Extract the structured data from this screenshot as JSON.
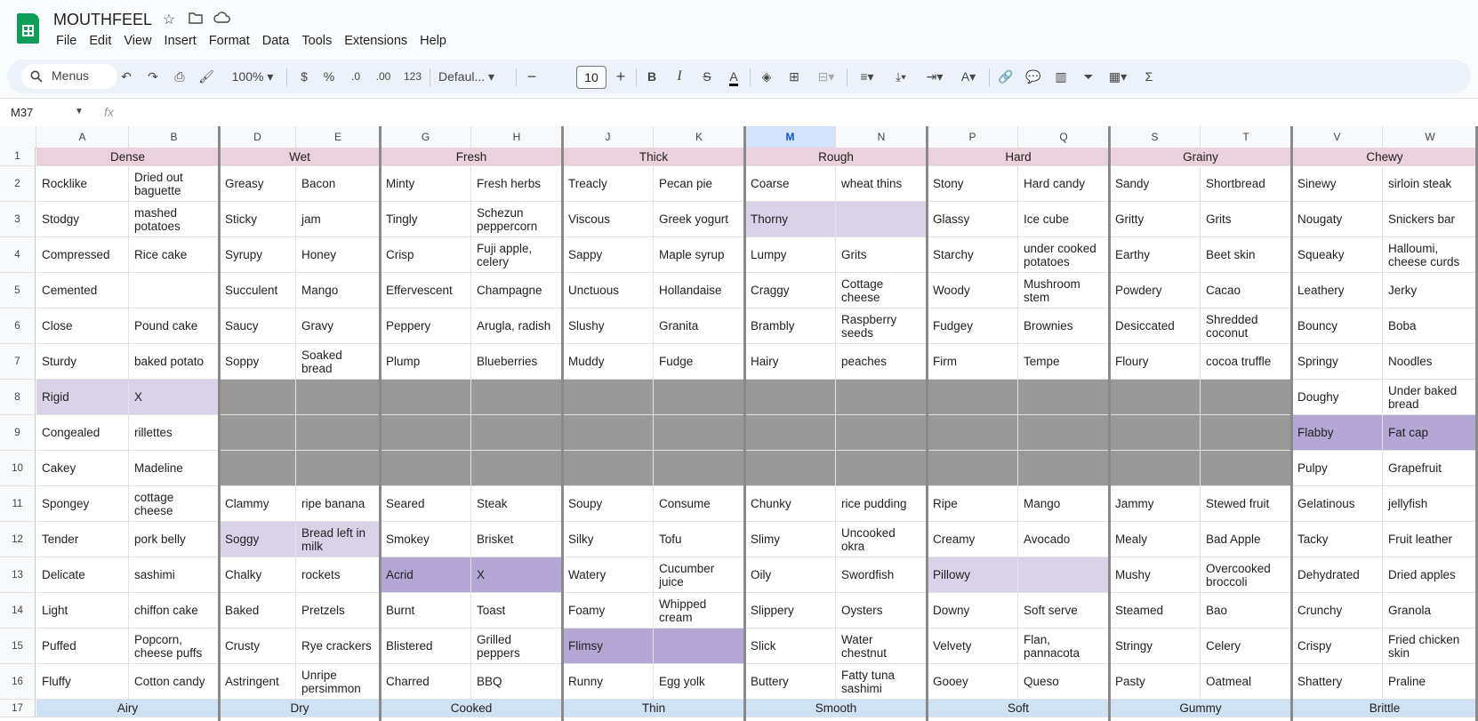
{
  "doc": {
    "title": "MOUTHFEEL"
  },
  "menu": [
    "File",
    "Edit",
    "View",
    "Insert",
    "Format",
    "Data",
    "Tools",
    "Extensions",
    "Help"
  ],
  "toolbar": {
    "search": "Menus",
    "zoom": "100%",
    "currency": "$",
    "percent": "%",
    "dec_dec": ".0",
    "inc_dec": ".00",
    "num_format": "123",
    "font": "Defaul...",
    "font_size": "10"
  },
  "formula": {
    "cell_ref": "M37",
    "fx": "fx",
    "value": ""
  },
  "columns": [
    "A",
    "B",
    "D",
    "E",
    "G",
    "H",
    "J",
    "K",
    "M",
    "N",
    "P",
    "Q",
    "S",
    "T",
    "V",
    "W"
  ],
  "selected_column": "M",
  "row_numbers": [
    "1",
    "2",
    "3",
    "4",
    "5",
    "6",
    "7",
    "8",
    "9",
    "10",
    "11",
    "12",
    "13",
    "14",
    "15",
    "16",
    "17"
  ],
  "group_headers_top": [
    "Dense",
    "Wet",
    "Fresh",
    "Thick",
    "Rough",
    "Hard",
    "Grainy",
    "Chewy"
  ],
  "group_headers_bottom": [
    "Airy",
    "Dry",
    "Cooked",
    "Thin",
    "Smooth",
    "Soft",
    "Gummy",
    "Brittle"
  ],
  "rows": [
    [
      "Rocklike",
      "Dried out baguette",
      "Greasy",
      "Bacon",
      "Minty",
      "Fresh herbs",
      "Treacly",
      "Pecan pie",
      "Coarse",
      "wheat thins",
      "Stony",
      "Hard candy",
      "Sandy",
      "Shortbread",
      "Sinewy",
      "sirloin steak"
    ],
    [
      "Stodgy",
      "mashed potatoes",
      "Sticky",
      "jam",
      "Tingly",
      "Schezun peppercorn",
      "Viscous",
      "Greek yogurt",
      "Thorny",
      "",
      "Glassy",
      "Ice cube",
      "Gritty",
      "Grits",
      "Nougaty",
      "Snickers bar"
    ],
    [
      "Compressed",
      "Rice cake",
      "Syrupy",
      "Honey",
      "Crisp",
      "Fuji apple, celery",
      "Sappy",
      "Maple syrup",
      "Lumpy",
      "Grits",
      "Starchy",
      "under cooked potatoes",
      "Earthy",
      "Beet skin",
      "Squeaky",
      "Halloumi, cheese curds"
    ],
    [
      "Cemented",
      "",
      "Succulent",
      "Mango",
      "Effervescent",
      "Champagne",
      "Unctuous",
      "Hollandaise",
      "Craggy",
      "Cottage cheese",
      "Woody",
      "Mushroom stem",
      "Powdery",
      "Cacao",
      "Leathery",
      "Jerky"
    ],
    [
      "Close",
      "Pound cake",
      "Saucy",
      "Gravy",
      "Peppery",
      "Arugla, radish",
      "Slushy",
      "Granita",
      "Brambly",
      "Raspberry seeds",
      "Fudgey",
      "Brownies",
      "Desiccated",
      "Shredded coconut",
      "Bouncy",
      "Boba"
    ],
    [
      "Sturdy",
      " baked potato",
      "Soppy",
      "Soaked bread",
      "Plump",
      "Blueberries",
      "Muddy",
      "Fudge",
      "Hairy",
      "peaches",
      "Firm",
      "Tempe",
      "Floury",
      "cocoa truffle",
      "Springy",
      "Noodles"
    ],
    [
      "Rigid",
      "X",
      "",
      "",
      "",
      "",
      "",
      "",
      "",
      "",
      "",
      "",
      "",
      "",
      "Doughy",
      "Under baked bread"
    ],
    [
      "Congealed",
      "rillettes",
      "",
      "",
      "",
      "",
      "",
      "",
      "",
      "",
      "",
      "",
      "",
      "",
      "Flabby",
      "Fat cap"
    ],
    [
      "Cakey",
      "Madeline",
      "",
      "",
      "",
      "",
      "",
      "",
      "",
      "",
      "",
      "",
      "",
      "",
      "Pulpy",
      "Grapefruit"
    ],
    [
      "Spongey",
      "cottage cheese",
      "Clammy",
      "ripe banana",
      "Seared",
      "Steak",
      "Soupy",
      "Consume",
      "Chunky",
      "rice pudding",
      "Ripe",
      "Mango",
      "Jammy",
      "Stewed fruit",
      "Gelatinous",
      "jellyfish"
    ],
    [
      "Tender",
      "pork belly",
      "Soggy",
      "Bread left in milk",
      "Smokey",
      "Brisket",
      "Silky",
      "Tofu",
      "Slimy",
      "Uncooked okra",
      "Creamy",
      "Avocado",
      "Mealy",
      "Bad Apple",
      "Tacky",
      "Fruit leather"
    ],
    [
      "Delicate",
      "sashimi",
      "Chalky",
      "rockets",
      "Acrid",
      "X",
      "Watery",
      "Cucumber juice",
      "Oily",
      "Swordfish",
      "Pillowy",
      "",
      "Mushy",
      "Overcooked broccoli",
      "Dehydrated",
      "Dried apples"
    ],
    [
      "Light",
      "chiffon cake",
      "Baked",
      "Pretzels",
      "Burnt",
      "Toast",
      "Foamy",
      "Whipped cream",
      "Slippery",
      "Oysters",
      "Downy",
      "Soft serve",
      "Steamed",
      "Bao",
      "Crunchy",
      "Granola"
    ],
    [
      "Puffed",
      "Popcorn, cheese puffs",
      "Crusty",
      "Rye crackers",
      "Blistered",
      "Grilled peppers",
      "Flimsy",
      "",
      "Slick",
      "Water chestnut",
      "Velvety",
      "Flan, pannacota",
      "Stringy",
      "Celery",
      "Crispy",
      "Fried chicken skin"
    ],
    [
      "Fluffy",
      "Cotton candy",
      "Astringent",
      "Unripe persimmon",
      "Charred",
      "BBQ",
      "Runny",
      "Egg yolk",
      "Buttery",
      "Fatty tuna sashimi",
      "Gooey",
      "Queso",
      "Pasty",
      "Oatmeal",
      "Shattery",
      "Praline"
    ]
  ],
  "colors": {
    "group_top": "#ead1dc",
    "group_bottom": "#cfe2f3",
    "light_purple": "#d9d2e9",
    "purple": "#b4a7d6",
    "gray": "#999999"
  }
}
